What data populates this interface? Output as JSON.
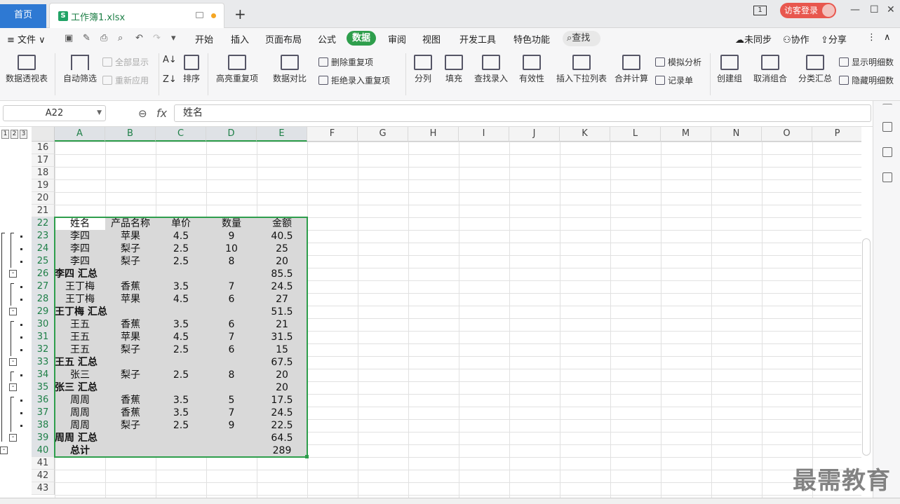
{
  "tabs": {
    "home_label": "首页",
    "file_label": "工作簿1.xlsx",
    "file_icon_letter": "S",
    "add_label": "+",
    "page_indicator": "1",
    "login_label": "访客登录"
  },
  "window_controls": {
    "minimize": "—",
    "maximize": "☐",
    "close": "✕"
  },
  "menubar": {
    "file_label": "≡ 文件 ∨",
    "items": [
      "开始",
      "插入",
      "页面布局",
      "公式",
      "数据",
      "审阅",
      "视图",
      "开发工具",
      "特色功能"
    ],
    "active": "数据",
    "search_label": "查找",
    "right": [
      "未同步",
      "协作",
      "分享"
    ]
  },
  "ribbon": {
    "pivot": "数据透视表",
    "autofilter": "自动筛选",
    "show_all": "全部显示",
    "reapply": "重新应用",
    "sort": "排序",
    "highlight_dup": "高亮重复项",
    "delete_dup": "删除重复项",
    "reject_dup": "拒绝录入重复项",
    "compare": "数据对比",
    "split": "分列",
    "fill": "填充",
    "lookup_entry": "查找录入",
    "validity": "有效性",
    "insert_dropdown": "插入下拉列表",
    "consolidate": "合并计算",
    "simulation": "模拟分析",
    "record_sheet": "记录单",
    "create_group": "创建组",
    "ungroup": "取消组合",
    "subtotal": "分类汇总",
    "show_detail": "显示明细数",
    "hide_detail": "隐藏明细数"
  },
  "formula_bar": {
    "name_box": "A22",
    "fx": "fx",
    "content": "姓名"
  },
  "outline_levels": [
    "1",
    "2",
    "3"
  ],
  "columns": [
    "A",
    "B",
    "C",
    "D",
    "E",
    "F",
    "G",
    "H",
    "I",
    "J",
    "K",
    "L",
    "M",
    "N",
    "O",
    "P"
  ],
  "rows": [
    "16",
    "17",
    "18",
    "19",
    "20",
    "21",
    "22",
    "23",
    "24",
    "25",
    "26",
    "27",
    "28",
    "29",
    "30",
    "31",
    "32",
    "33",
    "34",
    "35",
    "36",
    "37",
    "38",
    "39",
    "40",
    "41",
    "42",
    "43"
  ],
  "table": {
    "header": [
      "姓名",
      "产品名称",
      "单价",
      "数量",
      "金额"
    ],
    "rows": [
      [
        "李四",
        "苹果",
        "4.5",
        "9",
        "40.5"
      ],
      [
        "李四",
        "梨子",
        "2.5",
        "10",
        "25"
      ],
      [
        "李四",
        "梨子",
        "2.5",
        "8",
        "20"
      ],
      [
        "李四 汇总",
        "",
        "",
        "",
        "85.5"
      ],
      [
        "王丁梅",
        "香蕉",
        "3.5",
        "7",
        "24.5"
      ],
      [
        "王丁梅",
        "苹果",
        "4.5",
        "6",
        "27"
      ],
      [
        "王丁梅 汇总",
        "",
        "",
        "",
        "51.5"
      ],
      [
        "王五",
        "香蕉",
        "3.5",
        "6",
        "21"
      ],
      [
        "王五",
        "苹果",
        "4.5",
        "7",
        "31.5"
      ],
      [
        "王五",
        "梨子",
        "2.5",
        "6",
        "15"
      ],
      [
        "王五 汇总",
        "",
        "",
        "",
        "67.5"
      ],
      [
        "张三",
        "梨子",
        "2.5",
        "8",
        "20"
      ],
      [
        "张三 汇总",
        "",
        "",
        "",
        "20"
      ],
      [
        "周周",
        "香蕉",
        "3.5",
        "5",
        "17.5"
      ],
      [
        "周周",
        "香蕉",
        "3.5",
        "7",
        "24.5"
      ],
      [
        "周周",
        "梨子",
        "2.5",
        "9",
        "22.5"
      ],
      [
        "周周 汇总",
        "",
        "",
        "",
        "64.5"
      ],
      [
        "总计",
        "",
        "",
        "",
        "289"
      ]
    ]
  },
  "watermark": "最需教育",
  "accent_color": "#2e9e4c"
}
